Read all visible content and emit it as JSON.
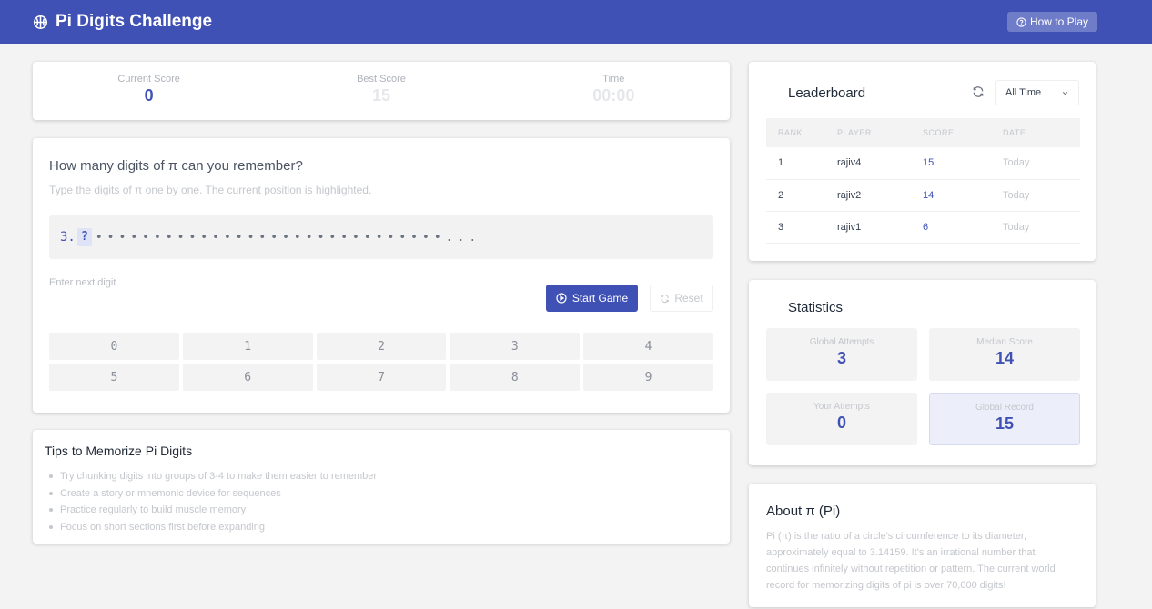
{
  "header": {
    "title": "Pi Digits Challenge",
    "how_to_play": "How to Play"
  },
  "score": {
    "current_label": "Current Score",
    "current_value": "0",
    "best_label": "Best Score",
    "best_value": "15",
    "time_label": "Time",
    "time_value": "00:00"
  },
  "game": {
    "question": "How many digits of π can you remember?",
    "description": "Type the digits of π one by one. The current position is highlighted.",
    "prefix": "3.",
    "current_marker": "?",
    "dots": "••••••••••••••••••••••••••••••...",
    "input_label": "Enter next digit",
    "start_label": "Start Game",
    "reset_label": "Reset",
    "keys": [
      "0",
      "1",
      "2",
      "3",
      "4",
      "5",
      "6",
      "7",
      "8",
      "9"
    ]
  },
  "tips": {
    "title": "Tips to Memorize Pi Digits",
    "items": [
      "Try chunking digits into groups of 3-4 to make them easier to remember",
      "Create a story or mnemonic device for sequences",
      "Practice regularly to build muscle memory",
      "Focus on short sections first before expanding"
    ]
  },
  "leaderboard": {
    "title": "Leaderboard",
    "filter": "All Time",
    "columns": [
      "RANK",
      "PLAYER",
      "SCORE",
      "DATE"
    ],
    "rows": [
      {
        "rank": "1",
        "player": "rajiv4",
        "score": "15",
        "date": "Today"
      },
      {
        "rank": "2",
        "player": "rajiv2",
        "score": "14",
        "date": "Today"
      },
      {
        "rank": "3",
        "player": "rajiv1",
        "score": "6",
        "date": "Today"
      }
    ]
  },
  "statistics": {
    "title": "Statistics",
    "global_attempts_label": "Global Attempts",
    "global_attempts": "3",
    "median_score_label": "Median Score",
    "median_score": "14",
    "your_attempts_label": "Your Attempts",
    "your_attempts": "0",
    "global_record_label": "Global Record",
    "global_record": "15"
  },
  "about": {
    "title": "About π (Pi)",
    "text": "Pi (π) is the ratio of a circle's circumference to its diameter, approximately equal to 3.14159. It's an irrational number that continues infinitely without repetition or pattern. The current world record for memorizing digits of pi is over 70,000 digits!"
  },
  "colors": {
    "accent": "#3f51b5",
    "background": "#f3f3f4"
  }
}
